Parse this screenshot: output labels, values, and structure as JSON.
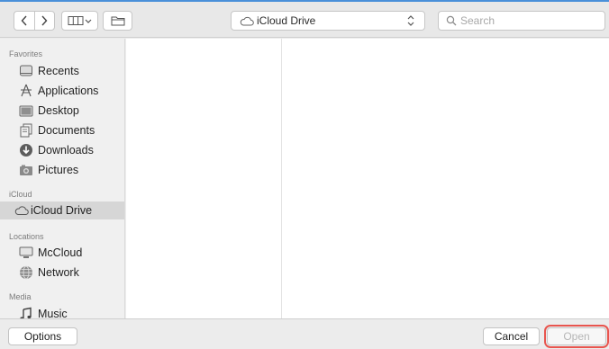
{
  "toolbar": {
    "back_icon": "chevron-left-icon",
    "forward_icon": "chevron-right-icon",
    "view_icon": "column-view-icon",
    "new_folder_icon": "new-folder-icon",
    "location": {
      "label": "iCloud Drive",
      "icon": "cloud-icon"
    },
    "search": {
      "placeholder": "Search",
      "icon": "search-icon"
    }
  },
  "sidebar": {
    "favorites_heading": "Favorites",
    "favorites": [
      {
        "label": "Recents",
        "icon": "recents-icon"
      },
      {
        "label": "Applications",
        "icon": "applications-icon"
      },
      {
        "label": "Desktop",
        "icon": "desktop-icon"
      },
      {
        "label": "Documents",
        "icon": "documents-icon"
      },
      {
        "label": "Downloads",
        "icon": "downloads-icon"
      },
      {
        "label": "Pictures",
        "icon": "pictures-icon"
      }
    ],
    "icloud_heading": "iCloud",
    "icloud": [
      {
        "label": "iCloud Drive",
        "icon": "cloud-icon",
        "selected": true
      }
    ],
    "locations_heading": "Locations",
    "locations": [
      {
        "label": "McCloud",
        "icon": "computer-icon"
      },
      {
        "label": "Network",
        "icon": "network-icon"
      }
    ],
    "media_heading": "Media",
    "media": [
      {
        "label": "Music",
        "icon": "music-icon"
      }
    ]
  },
  "bottom": {
    "options_label": "Options",
    "cancel_label": "Cancel",
    "open_label": "Open"
  },
  "colors": {
    "window_accent": "#4a90d9",
    "open_highlight": "#e8554e",
    "selected_row": "#d6d6d6"
  }
}
